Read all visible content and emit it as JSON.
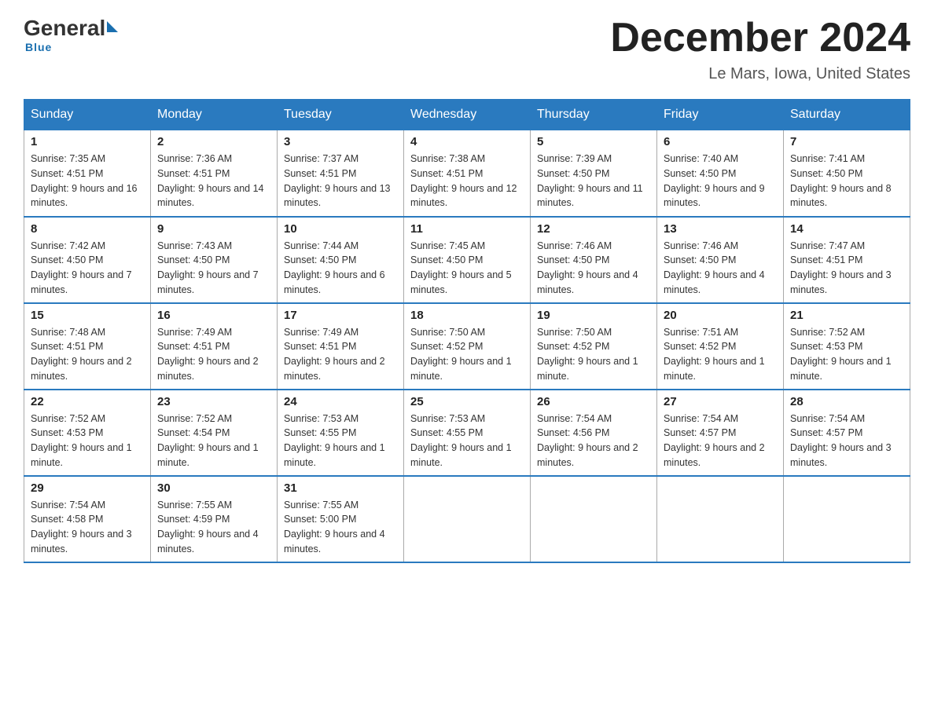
{
  "header": {
    "logo_general": "General",
    "logo_blue": "Blue",
    "month_title": "December 2024",
    "location": "Le Mars, Iowa, United States"
  },
  "days_of_week": [
    "Sunday",
    "Monday",
    "Tuesday",
    "Wednesday",
    "Thursday",
    "Friday",
    "Saturday"
  ],
  "weeks": [
    [
      {
        "day": "1",
        "sunrise": "7:35 AM",
        "sunset": "4:51 PM",
        "daylight": "9 hours and 16 minutes."
      },
      {
        "day": "2",
        "sunrise": "7:36 AM",
        "sunset": "4:51 PM",
        "daylight": "9 hours and 14 minutes."
      },
      {
        "day": "3",
        "sunrise": "7:37 AM",
        "sunset": "4:51 PM",
        "daylight": "9 hours and 13 minutes."
      },
      {
        "day": "4",
        "sunrise": "7:38 AM",
        "sunset": "4:51 PM",
        "daylight": "9 hours and 12 minutes."
      },
      {
        "day": "5",
        "sunrise": "7:39 AM",
        "sunset": "4:50 PM",
        "daylight": "9 hours and 11 minutes."
      },
      {
        "day": "6",
        "sunrise": "7:40 AM",
        "sunset": "4:50 PM",
        "daylight": "9 hours and 9 minutes."
      },
      {
        "day": "7",
        "sunrise": "7:41 AM",
        "sunset": "4:50 PM",
        "daylight": "9 hours and 8 minutes."
      }
    ],
    [
      {
        "day": "8",
        "sunrise": "7:42 AM",
        "sunset": "4:50 PM",
        "daylight": "9 hours and 7 minutes."
      },
      {
        "day": "9",
        "sunrise": "7:43 AM",
        "sunset": "4:50 PM",
        "daylight": "9 hours and 7 minutes."
      },
      {
        "day": "10",
        "sunrise": "7:44 AM",
        "sunset": "4:50 PM",
        "daylight": "9 hours and 6 minutes."
      },
      {
        "day": "11",
        "sunrise": "7:45 AM",
        "sunset": "4:50 PM",
        "daylight": "9 hours and 5 minutes."
      },
      {
        "day": "12",
        "sunrise": "7:46 AM",
        "sunset": "4:50 PM",
        "daylight": "9 hours and 4 minutes."
      },
      {
        "day": "13",
        "sunrise": "7:46 AM",
        "sunset": "4:50 PM",
        "daylight": "9 hours and 4 minutes."
      },
      {
        "day": "14",
        "sunrise": "7:47 AM",
        "sunset": "4:51 PM",
        "daylight": "9 hours and 3 minutes."
      }
    ],
    [
      {
        "day": "15",
        "sunrise": "7:48 AM",
        "sunset": "4:51 PM",
        "daylight": "9 hours and 2 minutes."
      },
      {
        "day": "16",
        "sunrise": "7:49 AM",
        "sunset": "4:51 PM",
        "daylight": "9 hours and 2 minutes."
      },
      {
        "day": "17",
        "sunrise": "7:49 AM",
        "sunset": "4:51 PM",
        "daylight": "9 hours and 2 minutes."
      },
      {
        "day": "18",
        "sunrise": "7:50 AM",
        "sunset": "4:52 PM",
        "daylight": "9 hours and 1 minute."
      },
      {
        "day": "19",
        "sunrise": "7:50 AM",
        "sunset": "4:52 PM",
        "daylight": "9 hours and 1 minute."
      },
      {
        "day": "20",
        "sunrise": "7:51 AM",
        "sunset": "4:52 PM",
        "daylight": "9 hours and 1 minute."
      },
      {
        "day": "21",
        "sunrise": "7:52 AM",
        "sunset": "4:53 PM",
        "daylight": "9 hours and 1 minute."
      }
    ],
    [
      {
        "day": "22",
        "sunrise": "7:52 AM",
        "sunset": "4:53 PM",
        "daylight": "9 hours and 1 minute."
      },
      {
        "day": "23",
        "sunrise": "7:52 AM",
        "sunset": "4:54 PM",
        "daylight": "9 hours and 1 minute."
      },
      {
        "day": "24",
        "sunrise": "7:53 AM",
        "sunset": "4:55 PM",
        "daylight": "9 hours and 1 minute."
      },
      {
        "day": "25",
        "sunrise": "7:53 AM",
        "sunset": "4:55 PM",
        "daylight": "9 hours and 1 minute."
      },
      {
        "day": "26",
        "sunrise": "7:54 AM",
        "sunset": "4:56 PM",
        "daylight": "9 hours and 2 minutes."
      },
      {
        "day": "27",
        "sunrise": "7:54 AM",
        "sunset": "4:57 PM",
        "daylight": "9 hours and 2 minutes."
      },
      {
        "day": "28",
        "sunrise": "7:54 AM",
        "sunset": "4:57 PM",
        "daylight": "9 hours and 3 minutes."
      }
    ],
    [
      {
        "day": "29",
        "sunrise": "7:54 AM",
        "sunset": "4:58 PM",
        "daylight": "9 hours and 3 minutes."
      },
      {
        "day": "30",
        "sunrise": "7:55 AM",
        "sunset": "4:59 PM",
        "daylight": "9 hours and 4 minutes."
      },
      {
        "day": "31",
        "sunrise": "7:55 AM",
        "sunset": "5:00 PM",
        "daylight": "9 hours and 4 minutes."
      },
      null,
      null,
      null,
      null
    ]
  ]
}
